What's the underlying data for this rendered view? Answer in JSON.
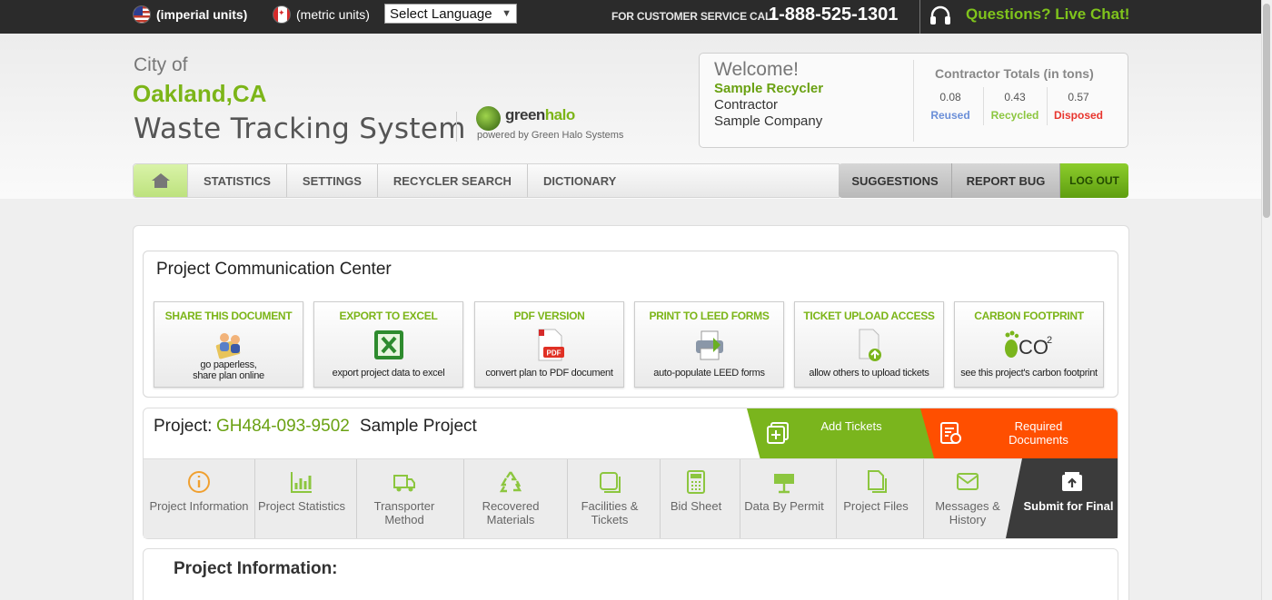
{
  "topbar": {
    "imperial": "(imperial units)",
    "metric": "(metric units)",
    "language": "Select Language",
    "cs_label": "FOR CUSTOMER SERVICE CALL",
    "cs_phone": "1-888-525-1301",
    "live_chat": "Questions? Live Chat!"
  },
  "header": {
    "city_of": "City of",
    "city_name": "Oakland,CA",
    "system_title": "Waste Tracking System",
    "logo_green": "green",
    "logo_halo": "halo",
    "powered_by": "powered by Green Halo Systems"
  },
  "welcome": {
    "greeting": "Welcome!",
    "name": "Sample Recycler",
    "role": "Contractor",
    "company": "Sample Company",
    "totals_title": "Contractor Totals (in tons)",
    "totals": [
      {
        "value": "0.08",
        "label": "Reused",
        "color": "#6b8fd8"
      },
      {
        "value": "0.43",
        "label": "Recycled",
        "color": "#8cc63f"
      },
      {
        "value": "0.57",
        "label": "Disposed",
        "color": "#e8352e"
      }
    ]
  },
  "nav": {
    "items": [
      "STATISTICS",
      "SETTINGS",
      "RECYCLER SEARCH",
      "DICTIONARY"
    ],
    "right": [
      "SUGGESTIONS",
      "REPORT BUG",
      "LOG OUT"
    ]
  },
  "pcc": {
    "title": "Project Communication Center",
    "cards": [
      {
        "title": "SHARE THIS DOCUMENT",
        "desc": "go paperless, share plan online",
        "icon": "share-people-icon"
      },
      {
        "title": "EXPORT TO EXCEL",
        "desc": "export project data to excel",
        "icon": "excel-icon"
      },
      {
        "title": "PDF VERSION",
        "desc": "convert plan to PDF document",
        "icon": "pdf-icon"
      },
      {
        "title": "PRINT TO LEED FORMS",
        "desc": "auto-populate LEED forms",
        "icon": "printer-icon"
      },
      {
        "title": "TICKET UPLOAD ACCESS",
        "desc": "allow others to upload tickets",
        "icon": "upload-document-icon"
      },
      {
        "title": "CARBON FOOTPRINT",
        "desc": "see this project's carbon footprint",
        "icon": "co2-footprint-icon"
      }
    ]
  },
  "project": {
    "label": "Project:",
    "code": "GH484-093-9502",
    "name": "Sample Project",
    "add_tickets": "Add Tickets",
    "required_docs": "Required Documents",
    "tabs": [
      {
        "label": "Project Information",
        "icon": "info-icon",
        "color": "#f0a030"
      },
      {
        "label": "Project Statistics",
        "icon": "chart-icon",
        "color": "#8cc63f"
      },
      {
        "label": "Transporter Method",
        "icon": "truck-icon",
        "color": "#8cc63f"
      },
      {
        "label": "Recovered Materials",
        "icon": "recycle-icon",
        "color": "#8cc63f"
      },
      {
        "label": "Facilities & Tickets",
        "icon": "ticket-icon",
        "color": "#8cc63f"
      },
      {
        "label": "Bid Sheet",
        "icon": "calculator-icon",
        "color": "#8cc63f"
      },
      {
        "label": "Data By Permit",
        "icon": "permit-sign-icon",
        "color": "#8cc63f"
      },
      {
        "label": "Project Files",
        "icon": "files-icon",
        "color": "#8cc63f"
      },
      {
        "label": "Messages & History",
        "icon": "mail-icon",
        "color": "#8cc63f"
      },
      {
        "label": "Submit for Final",
        "icon": "submit-icon",
        "color": "#ffffff"
      }
    ],
    "section_title": "Project Information:"
  }
}
